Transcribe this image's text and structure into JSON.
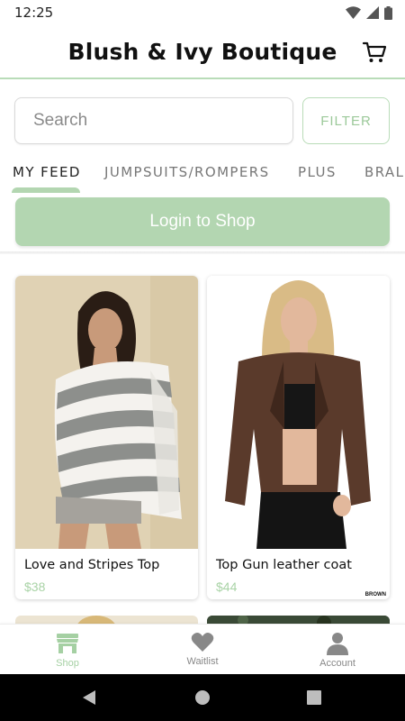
{
  "status_bar": {
    "time": "12:25"
  },
  "header": {
    "title": "Blush & Ivy Boutique",
    "cart_icon": "cart-icon"
  },
  "search": {
    "placeholder": "Search",
    "value": "",
    "filter_label": "FILTER"
  },
  "tabs": [
    {
      "label": "MY FEED",
      "active": true
    },
    {
      "label": "JUMPSUITS/ROMPERS",
      "active": false
    },
    {
      "label": "PLUS",
      "active": false
    },
    {
      "label": "BRALETTES",
      "active": false
    }
  ],
  "login": {
    "label": "Login to Shop"
  },
  "products": [
    {
      "name": "Love and Stripes Top",
      "price": "$38",
      "image": "striped off-shoulder sweater"
    },
    {
      "name": "Top Gun leather coat",
      "price": "$44",
      "image": "brown leather moto jacket",
      "tag": "BROWN"
    }
  ],
  "bottom_nav": [
    {
      "label": "Shop",
      "icon": "shop-icon",
      "active": true
    },
    {
      "label": "Waitlist",
      "icon": "heart-icon",
      "active": false
    },
    {
      "label": "Account",
      "icon": "person-icon",
      "active": false
    }
  ],
  "colors": {
    "accent": "#b3d6b1",
    "accent_text": "#9cc99a",
    "price": "#a9d3a6"
  }
}
